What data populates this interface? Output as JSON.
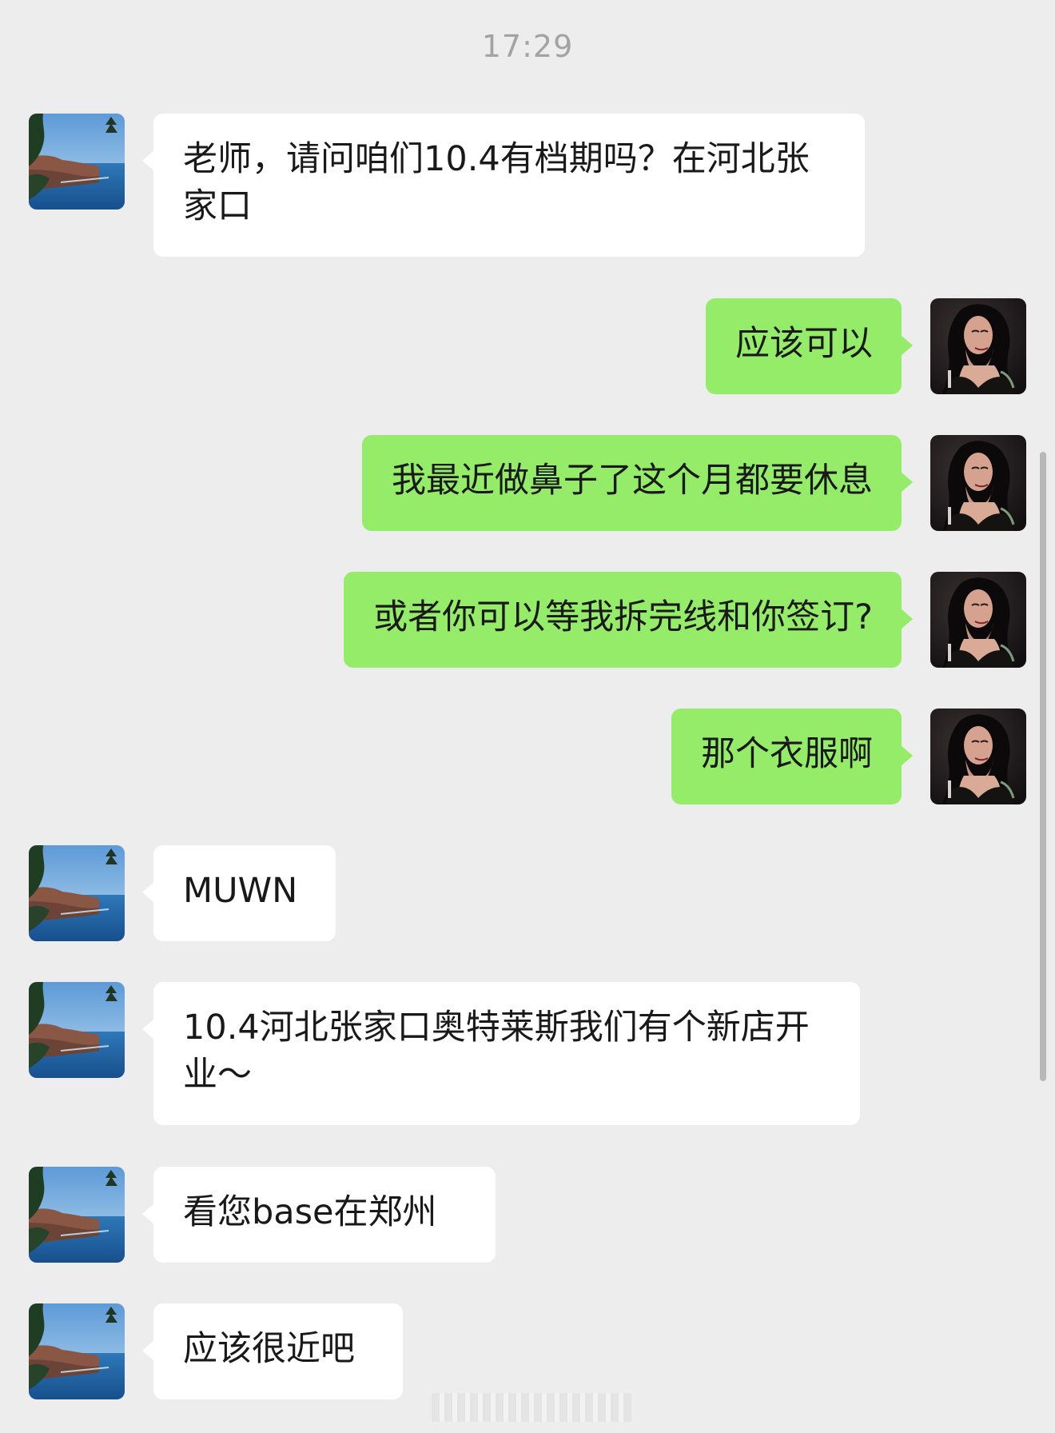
{
  "chat": {
    "timestamp": "17:29",
    "messages": [
      {
        "side": "left",
        "text": "老师，请问咱们10.4有档期吗？在河北张家口"
      },
      {
        "side": "right",
        "text": "应该可以"
      },
      {
        "side": "right",
        "text": "我最近做鼻子了这个月都要休息"
      },
      {
        "side": "right",
        "text": "或者你可以等我拆完线和你签订?"
      },
      {
        "side": "right",
        "text": "那个衣服啊"
      },
      {
        "side": "left",
        "text": "MUWN"
      },
      {
        "side": "left",
        "text": "10.4河北张家口奥特莱斯我们有个新店开业～"
      },
      {
        "side": "left",
        "text": "看您base在郑州"
      },
      {
        "side": "left",
        "text": "应该很近吧"
      }
    ]
  },
  "avatars": {
    "left_icon": "seaside-cliff-avatar",
    "right_icon": "portrait-avatar"
  },
  "colors": {
    "background": "#ededed",
    "incoming_bubble": "#ffffff",
    "outgoing_bubble": "#95ec69",
    "timestamp_text": "#a3a3a3",
    "message_text": "#191919"
  }
}
